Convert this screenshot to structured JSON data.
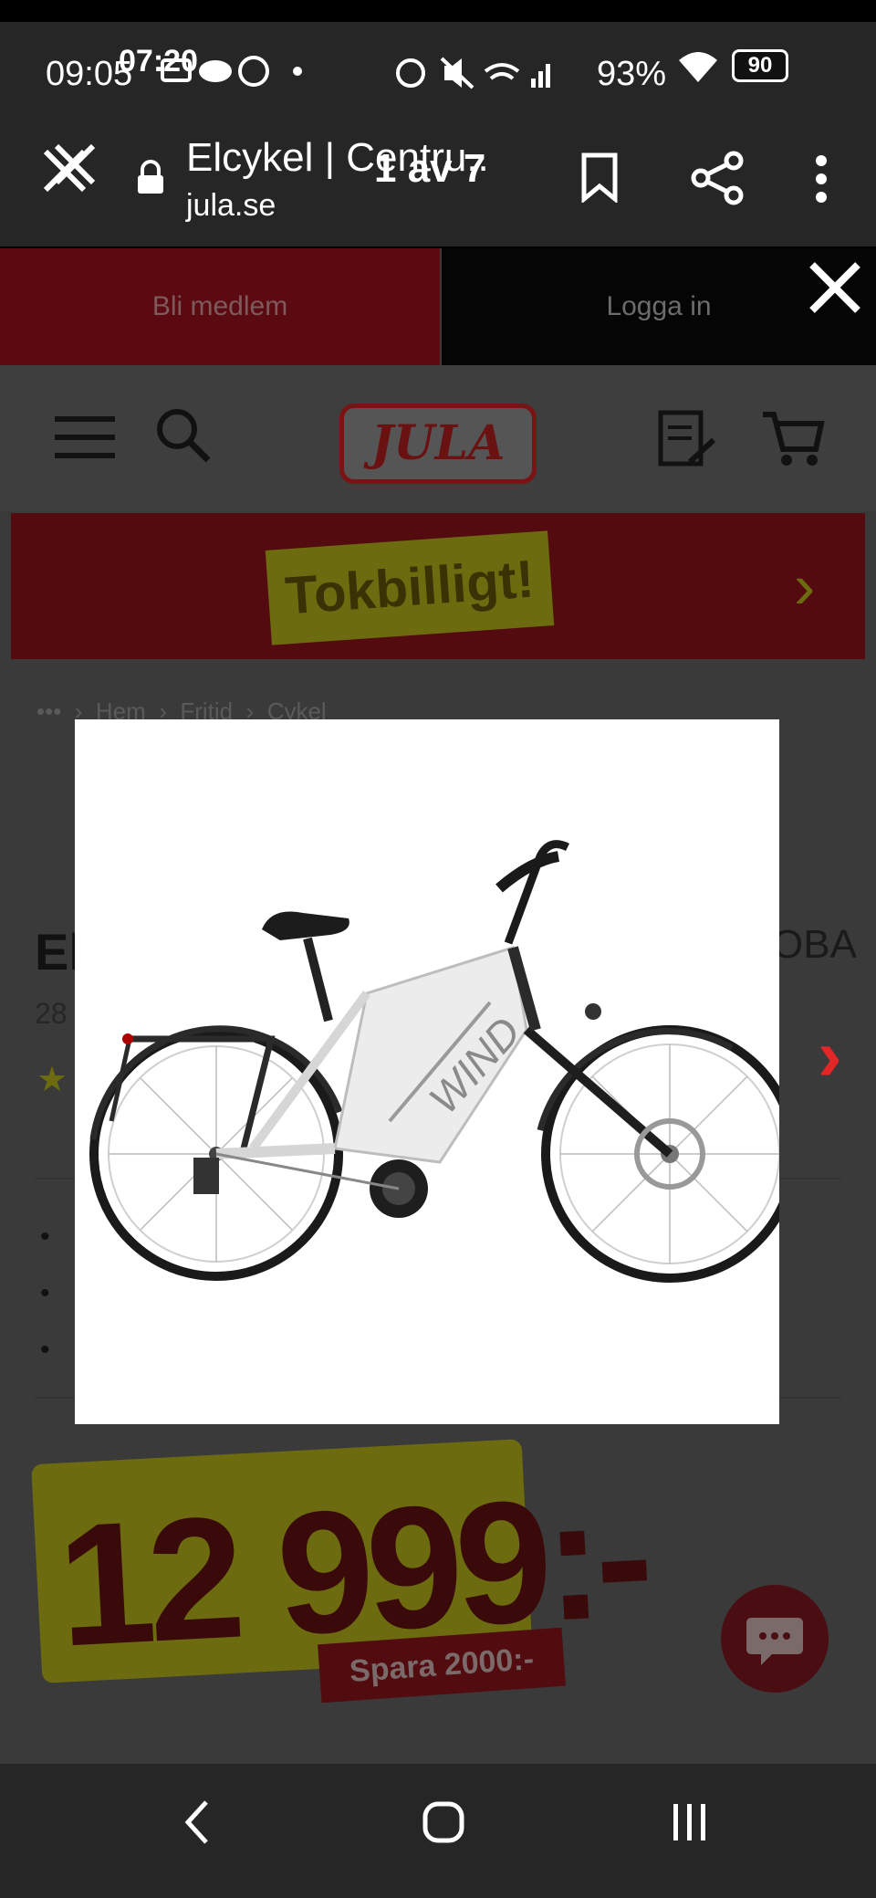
{
  "status_bar": {
    "time": "09:05",
    "time_overlay": "07:20",
    "battery": "93%",
    "badge": "90"
  },
  "browser": {
    "page_title": "Elcykel | Centru..",
    "domain": "jula.se",
    "gallery_counter": "1 av 7"
  },
  "site": {
    "member_link": "Bli medlem",
    "login_link": "Logga in",
    "logo_text": "JULA",
    "promo": "Tokbilligt!",
    "breadcrumb": [
      "Hem",
      "Fritid",
      "Cykel"
    ],
    "product_title_start": "El",
    "product_title_end": "OBA",
    "product_subtitle": "28",
    "price": "12 999:-",
    "savings": "Spara 2000:-"
  },
  "gallery": {
    "photo_brand": "WIND"
  }
}
